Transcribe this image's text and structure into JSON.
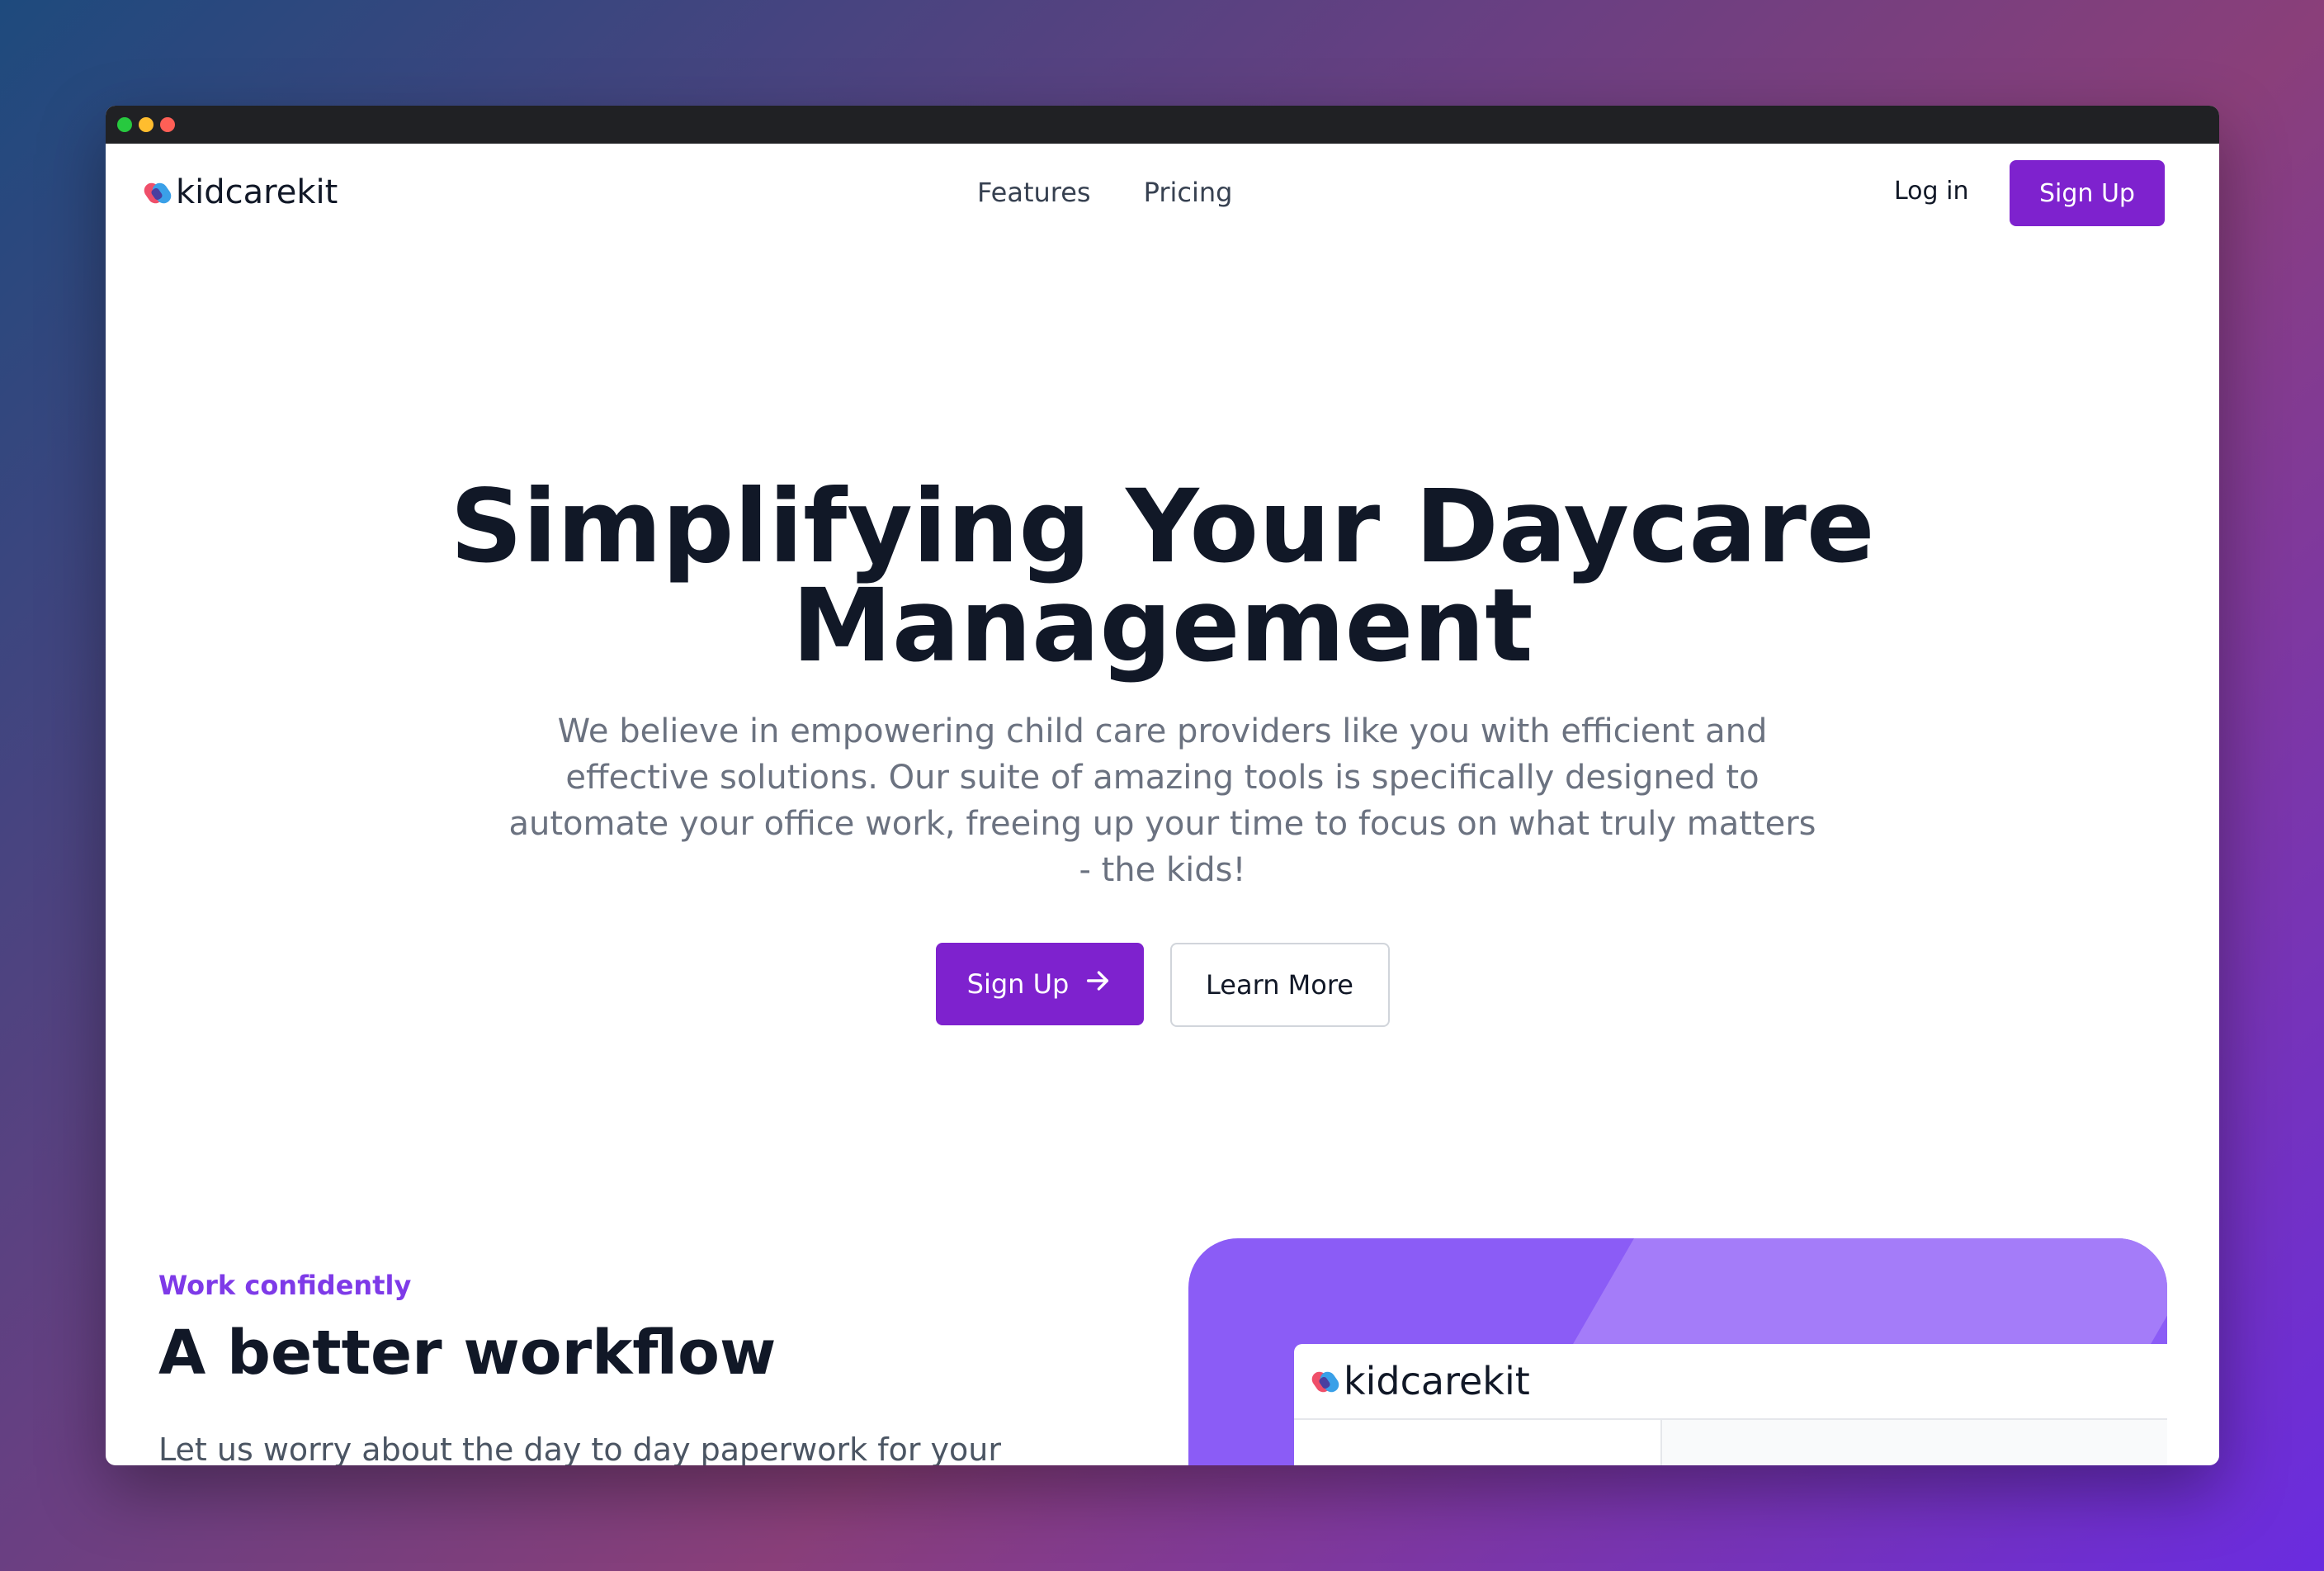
{
  "brand": {
    "name": "kidcarekit"
  },
  "nav": {
    "links": [
      "Features",
      "Pricing"
    ],
    "login": "Log in",
    "signup": "Sign Up"
  },
  "hero": {
    "title": "Simplifying Your Daycare Management",
    "description": "We believe in empowering child care providers like you with efficient and effective solutions. Our suite of amazing tools is specifically designed to automate your office work, freeing up your time to focus on what truly matters - the kids!",
    "primary_cta": "Sign Up",
    "secondary_cta": "Learn More"
  },
  "feature": {
    "eyebrow": "Work confidently",
    "title": "A better workflow",
    "description": "Let us worry about the day to day paperwork for your"
  },
  "preview": {
    "brand": "kidcarekit"
  },
  "colors": {
    "accent": "#7e22ce",
    "eyebrow": "#7e3ae8",
    "preview_bg": "#8b5cf6"
  },
  "icons": {
    "cta_arrow": "arrow-right-icon",
    "window_controls": [
      "green-dot",
      "yellow-dot",
      "red-dot"
    ]
  }
}
